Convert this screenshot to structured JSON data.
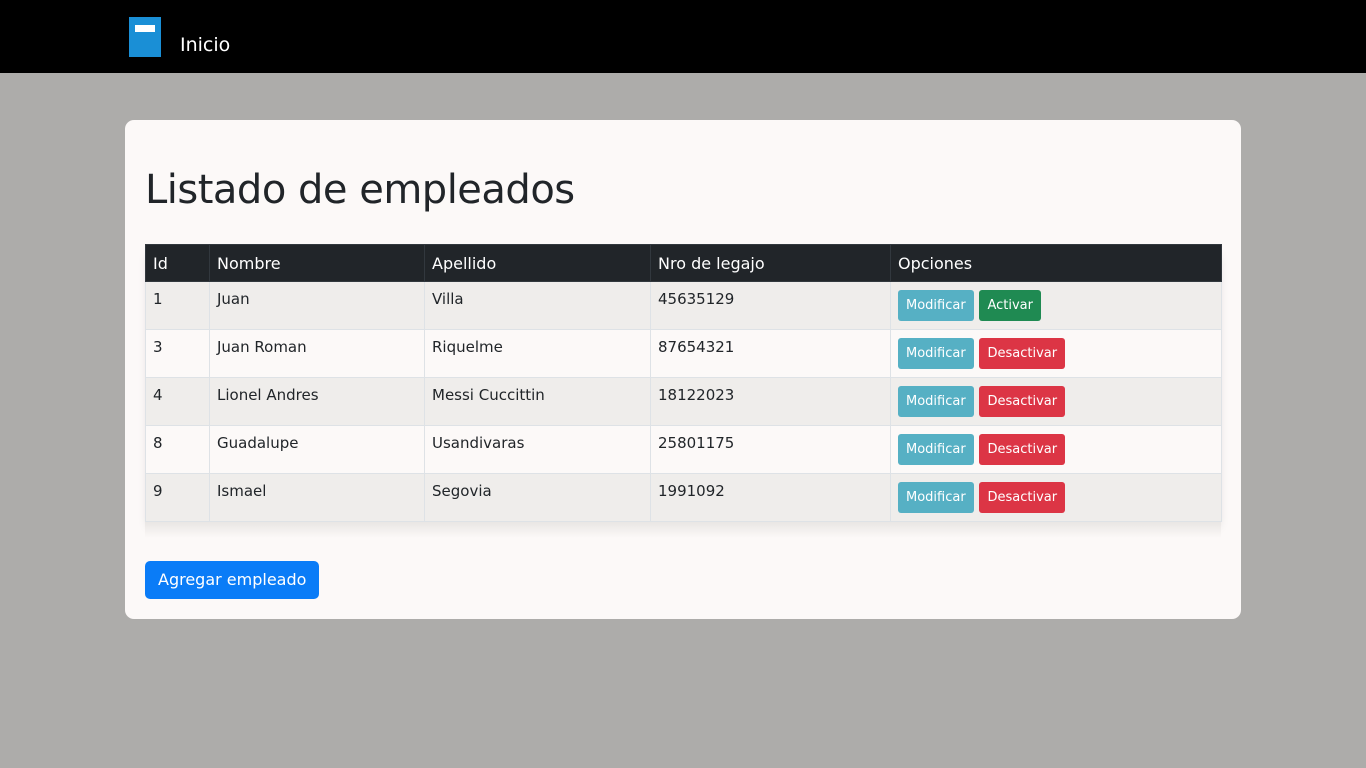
{
  "nav": {
    "home_label": "Inicio",
    "brand_icon": "book-icon"
  },
  "page": {
    "title": "Listado de empleados"
  },
  "table": {
    "headers": [
      "Id",
      "Nombre",
      "Apellido",
      "Nro de legajo",
      "Opciones"
    ],
    "rows": [
      {
        "id": "1",
        "nombre": "Juan",
        "apellido": "Villa",
        "legajo": "45635129",
        "modify_label": "Modificar",
        "toggle_label": "Activar",
        "toggle_state": "inactive"
      },
      {
        "id": "3",
        "nombre": "Juan Roman",
        "apellido": "Riquelme",
        "legajo": "87654321",
        "modify_label": "Modificar",
        "toggle_label": "Desactivar",
        "toggle_state": "active"
      },
      {
        "id": "4",
        "nombre": "Lionel Andres",
        "apellido": "Messi Cuccittin",
        "legajo": "18122023",
        "modify_label": "Modificar",
        "toggle_label": "Desactivar",
        "toggle_state": "active"
      },
      {
        "id": "8",
        "nombre": "Guadalupe",
        "apellido": "Usandivaras",
        "legajo": "25801175",
        "modify_label": "Modificar",
        "toggle_label": "Desactivar",
        "toggle_state": "active"
      },
      {
        "id": "9",
        "nombre": "Ismael",
        "apellido": "Segovia",
        "legajo": "1991092",
        "modify_label": "Modificar",
        "toggle_label": "Desactivar",
        "toggle_state": "active"
      }
    ]
  },
  "actions": {
    "add_label": "Agregar empleado"
  },
  "colors": {
    "navbar": "#000000",
    "background": "#adacaa",
    "info": "#56b0c4",
    "success": "#1f8a52",
    "danger": "#dc3545",
    "primary": "#0a7cf7"
  }
}
